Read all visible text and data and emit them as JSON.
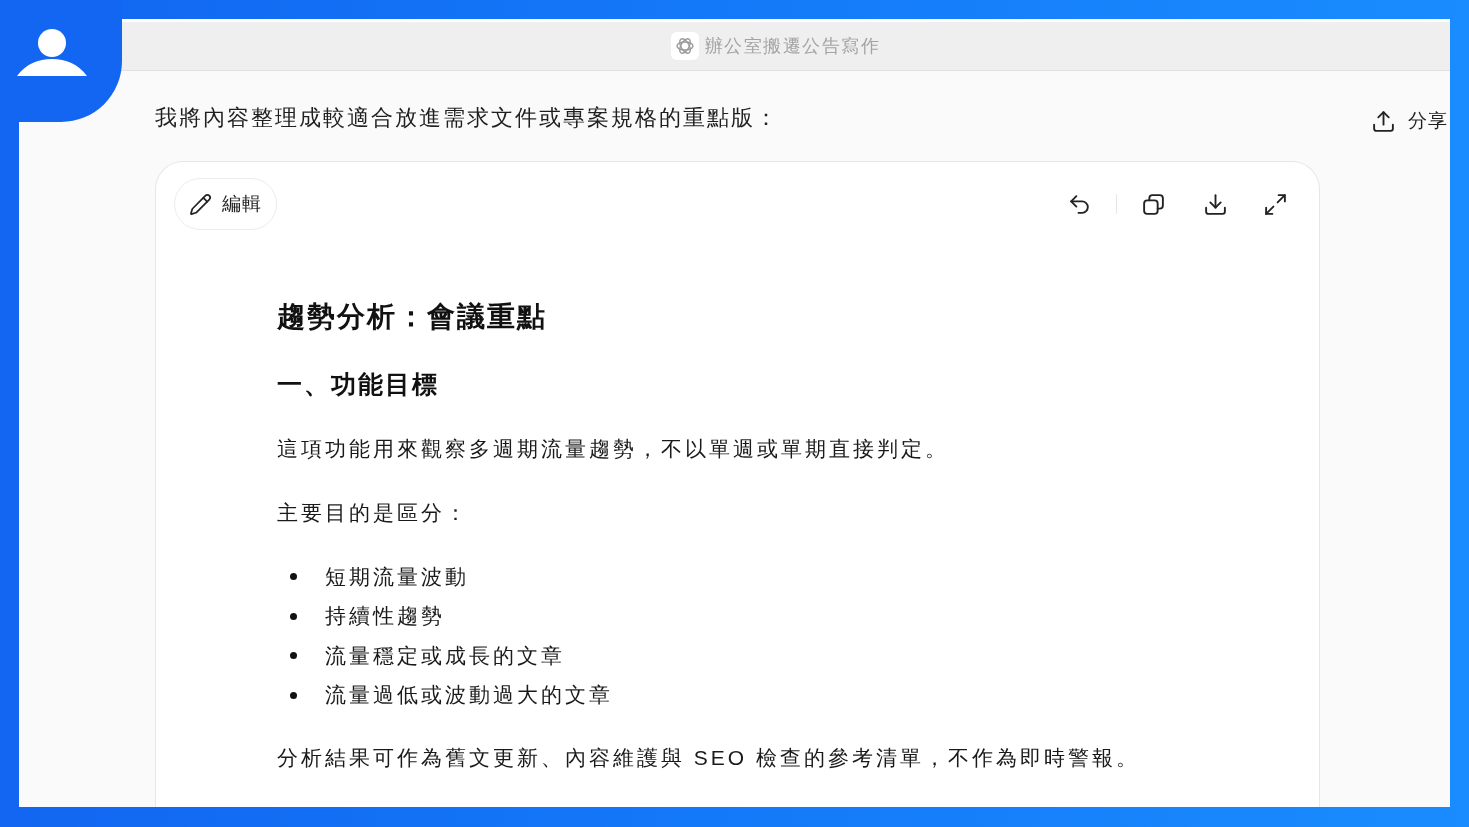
{
  "window": {
    "title": "辦公室搬遷公告寫作"
  },
  "chat": {
    "message": "我將內容整理成較適合放進需求文件或專案規格的重點版：",
    "share_button": {
      "label": "分享"
    }
  },
  "document": {
    "edit_button": {
      "label": "編輯"
    },
    "blocks": [
      {
        "kind": "title",
        "text": "趨勢分析：會議重點"
      },
      {
        "kind": "heading",
        "text": "一、功能目標"
      },
      {
        "kind": "paragraph",
        "text": "這項功能用來觀察多週期流量趨勢，不以單週或單期直接判定。"
      },
      {
        "kind": "paragraph",
        "text": "主要目的是區分："
      },
      {
        "kind": "bullets",
        "items": [
          "短期流量波動",
          "持續性趨勢",
          "流量穩定或成長的文章",
          "流量過低或波動過大的文章"
        ]
      },
      {
        "kind": "paragraph",
        "text": "分析結果可作為舊文更新、內容維護與 SEO 檢查的參考清單，不作為即時警報。"
      }
    ]
  }
}
